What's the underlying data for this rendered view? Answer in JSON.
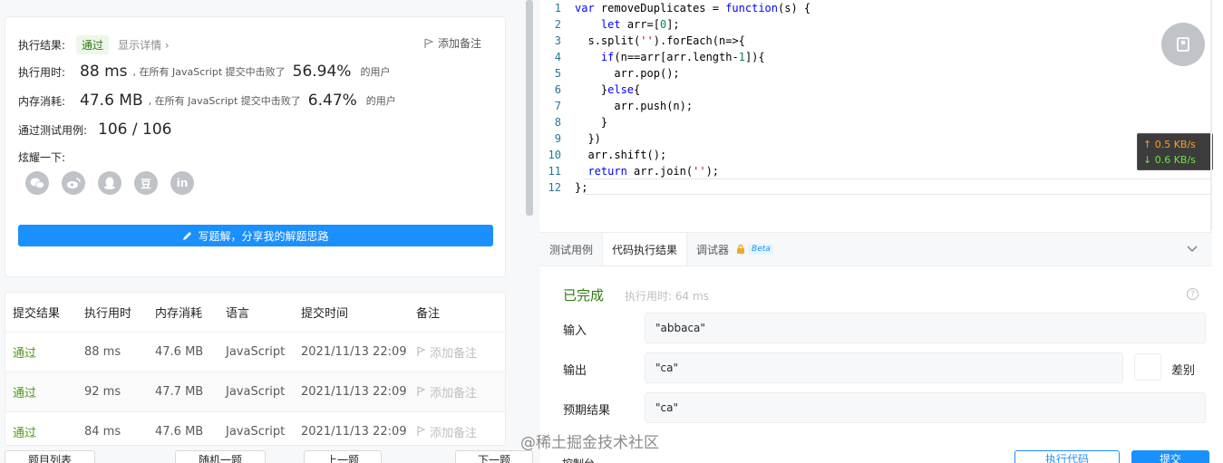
{
  "result": {
    "status_label": "执行结果:",
    "status": "通过",
    "details": "显示详情 ›",
    "add_note": "添加备注",
    "runtime_label": "执行用时:",
    "runtime": "88 ms",
    "runtime_beat_prefix": ", 在所有 JavaScript 提交中击败了",
    "runtime_percent": "56.94%",
    "runtime_beat_suffix": "的用户",
    "memory_label": "内存消耗:",
    "memory": "47.6 MB",
    "memory_beat_prefix": ", 在所有 JavaScript 提交中击败了",
    "memory_percent": "6.47%",
    "memory_beat_suffix": "的用户",
    "tests_label": "通过测试用例:",
    "tests": "106 / 106",
    "share_label": "炫耀一下:",
    "share_icons": [
      "wechat-icon",
      "weibo-icon",
      "qq-icon",
      "douban-icon",
      "linkedin-icon"
    ],
    "share_glyph_douban": "豆",
    "share_glyph_linkedin": "in",
    "write_solution": "写题解，分享我的解题思路"
  },
  "submissions": {
    "headers": [
      "提交结果",
      "执行用时",
      "内存消耗",
      "语言",
      "提交时间",
      "备注"
    ],
    "rows": [
      {
        "status": "通过",
        "time": "88 ms",
        "memory": "47.6 MB",
        "lang": "JavaScript",
        "date": "2021/11/13 22:09",
        "note": "添加备注"
      },
      {
        "status": "通过",
        "time": "92 ms",
        "memory": "47.7 MB",
        "lang": "JavaScript",
        "date": "2021/11/13 22:09",
        "note": "添加备注"
      },
      {
        "status": "通过",
        "time": "84 ms",
        "memory": "47.6 MB",
        "lang": "JavaScript",
        "date": "2021/11/13 22:09",
        "note": "添加备注"
      }
    ]
  },
  "bottom_nav": {
    "problem_list": "题目列表",
    "random": "随机一题",
    "prev": "上一题",
    "next": "下一题"
  },
  "editor": {
    "lines": [
      "var removeDuplicates = function(s) {",
      "    let arr=[0];",
      "  s.split('').forEach(n=>{",
      "    if(n==arr[arr.length-1]){",
      "      arr.pop();",
      "    }else{",
      "      arr.push(n);",
      "    }",
      "  })",
      "  arr.shift();",
      "  return arr.join('');",
      "};"
    ],
    "line_numbers": [
      "1",
      "2",
      "3",
      "4",
      "5",
      "6",
      "7",
      "8",
      "9",
      "10",
      "11",
      "12"
    ]
  },
  "netspeed": {
    "up": "↑ 0.5 KB/s",
    "down": "↓ 0.6 KB/s"
  },
  "console": {
    "tabs": [
      "测试用例",
      "代码执行结果",
      "调试器"
    ],
    "beta": "Beta",
    "done": "已完成",
    "exec_time": "执行用时: 64 ms",
    "input_label": "输入",
    "input_value": "\"abbaca\"",
    "output_label": "输出",
    "output_value": "\"ca\"",
    "diff_label": "差别",
    "expected_label": "预期结果",
    "expected_value": "\"ca\"",
    "help_glyph": "?"
  },
  "bottom_right": {
    "console_toggle": "控制台",
    "run": "执行代码",
    "submit": "提交"
  },
  "watermark": "@稀土掘金技术社区",
  "colors": {
    "accent": "#1a90ff",
    "success": "#2f7a12",
    "netspeed_up": "#ff9c2a",
    "netspeed_down": "#70e044"
  }
}
